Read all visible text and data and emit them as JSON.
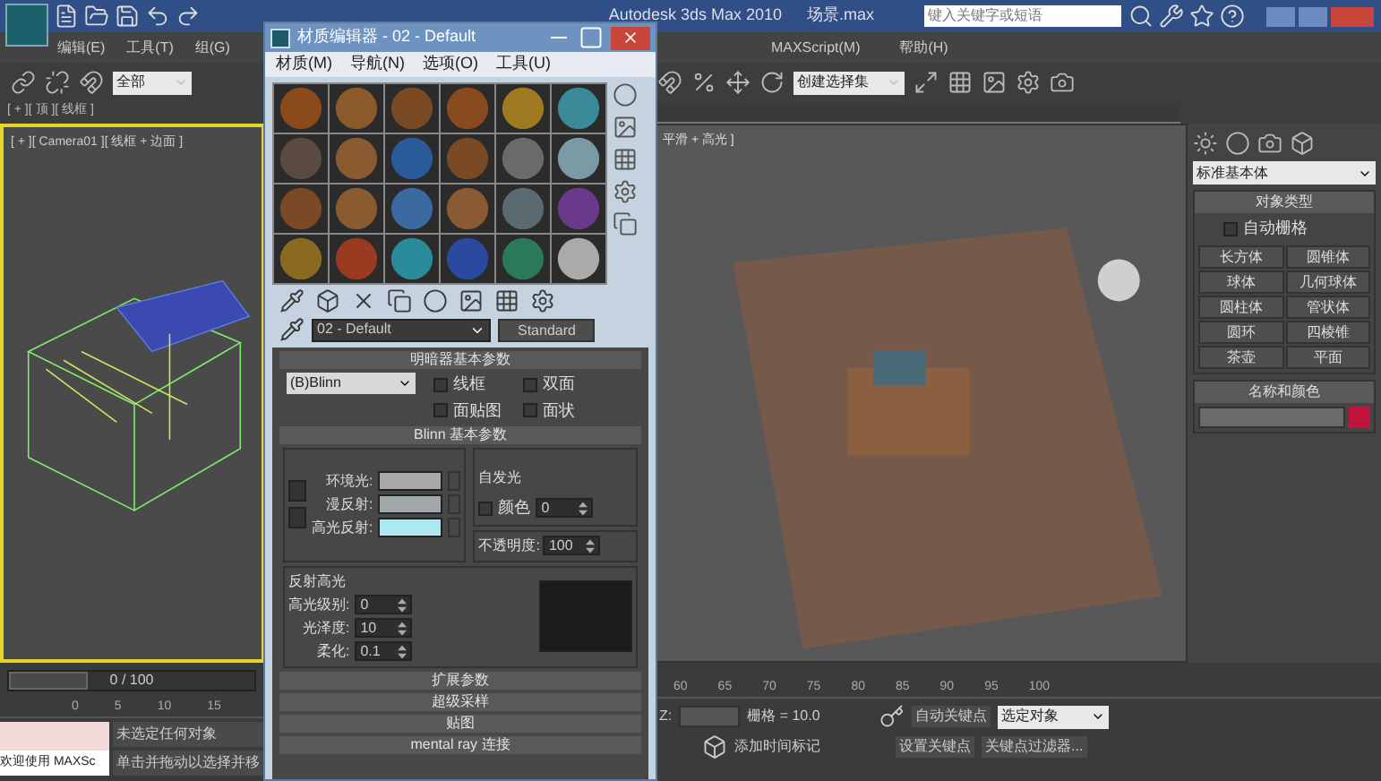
{
  "app": {
    "title": "Autodesk 3ds Max 2010",
    "file": "场景.max",
    "search_placeholder": "键入关键字或短语"
  },
  "menu": [
    "编辑(E)",
    "工具(T)",
    "组(G)",
    "MAXScript(M)",
    "帮助(H)"
  ],
  "toolbar": {
    "selection_filter": "全部",
    "named_selection": "创建选择集"
  },
  "viewports": [
    {
      "label": "[ + ][ 顶 ][ 线框 ]"
    },
    {
      "label": "[ + ][ Camera01 ][ 线框 + 边面 ]",
      "active": true
    },
    {
      "label": "平滑 + 高光 ]",
      "active": false
    }
  ],
  "material_editor": {
    "title": "材质编辑器 - 02 - Default",
    "menu": [
      "材质(M)",
      "导航(N)",
      "选项(O)",
      "工具(U)"
    ],
    "slots": [
      {
        "color": "#8a4a1a"
      },
      {
        "color": "#8a5a2a"
      },
      {
        "color": "#7a4a25"
      },
      {
        "color": "#8a4a20"
      },
      {
        "color": "#a07a20"
      },
      {
        "color": "#3a8a9a"
      },
      {
        "color": "#5a4a40"
      },
      {
        "color": "#8a5a30"
      },
      {
        "color": "#2a5a9a"
      },
      {
        "color": "#7a4a25"
      },
      {
        "color": "#6a6a6a"
      },
      {
        "color": "#7a9aa5"
      },
      {
        "color": "#7a4a26"
      },
      {
        "color": "#8a5a31"
      },
      {
        "color": "#3a6aa0"
      },
      {
        "color": "#8a5a32"
      },
      {
        "color": "#5a6a70"
      },
      {
        "color": "#6a3a8a"
      },
      {
        "color": "#8a6a20"
      },
      {
        "color": "#9a3a20"
      },
      {
        "color": "#2a8a9a"
      },
      {
        "color": "#2a4aa0"
      },
      {
        "color": "#2a7a5a"
      },
      {
        "color": "#aaaaaa"
      }
    ],
    "name": "02 - Default",
    "type_button": "Standard",
    "shader": {
      "title": "明暗器基本参数",
      "shader": "(B)Blinn",
      "options": [
        {
          "label": "线框",
          "checked": false
        },
        {
          "label": "双面",
          "checked": false
        },
        {
          "label": "面贴图",
          "checked": false
        },
        {
          "label": "面状",
          "checked": false
        }
      ]
    },
    "blinn": {
      "title": "Blinn 基本参数",
      "self_illum": {
        "title": "自发光",
        "label": "颜色",
        "checked": false,
        "value": "0"
      },
      "colors": [
        {
          "label": "环境光:",
          "color": "#a8a8a8"
        },
        {
          "label": "漫反射:",
          "color": "#a0a8ac"
        },
        {
          "label": "高光反射:",
          "color": "#aee8ee"
        }
      ],
      "opacity": {
        "label": "不透明度:",
        "value": "100"
      },
      "highlights": {
        "title": "反射高光",
        "fields": [
          {
            "label": "高光级别:",
            "value": "0"
          },
          {
            "label": "光泽度:",
            "value": "10"
          },
          {
            "label": "柔化:",
            "value": "0.1"
          }
        ]
      }
    },
    "collapsed": [
      "扩展参数",
      "超级采样",
      "贴图",
      "mental ray 连接"
    ]
  },
  "command_panel": {
    "category": "标准基本体",
    "object_type": {
      "title": "对象类型",
      "autogrid": {
        "label": "自动栅格",
        "checked": false
      },
      "buttons": [
        "长方体",
        "圆锥体",
        "球体",
        "几何球体",
        "圆柱体",
        "管状体",
        "圆环",
        "四棱锥",
        "茶壶",
        "平面"
      ]
    },
    "name_color": {
      "title": "名称和颜色",
      "color": "#c0143c"
    }
  },
  "timeline": {
    "label": "0 / 100",
    "level": 0,
    "left_ticks": [
      "0",
      "5",
      "10",
      "15"
    ],
    "right_ticks": [
      "60",
      "65",
      "70",
      "75",
      "80",
      "85",
      "90",
      "95",
      "100"
    ]
  },
  "status": {
    "welcome": "欢迎使用 MAXSc",
    "selection": "未选定任何对象",
    "prompt": "单击并拖动以选择并移",
    "z_label": "Z:",
    "grid": "栅格 = 10.0",
    "time_tag": "添加时间标记",
    "auto_key": "自动关键点",
    "key_mode": "选定对象",
    "set_key": "设置关键点",
    "key_filters": "关键点过滤器..."
  }
}
